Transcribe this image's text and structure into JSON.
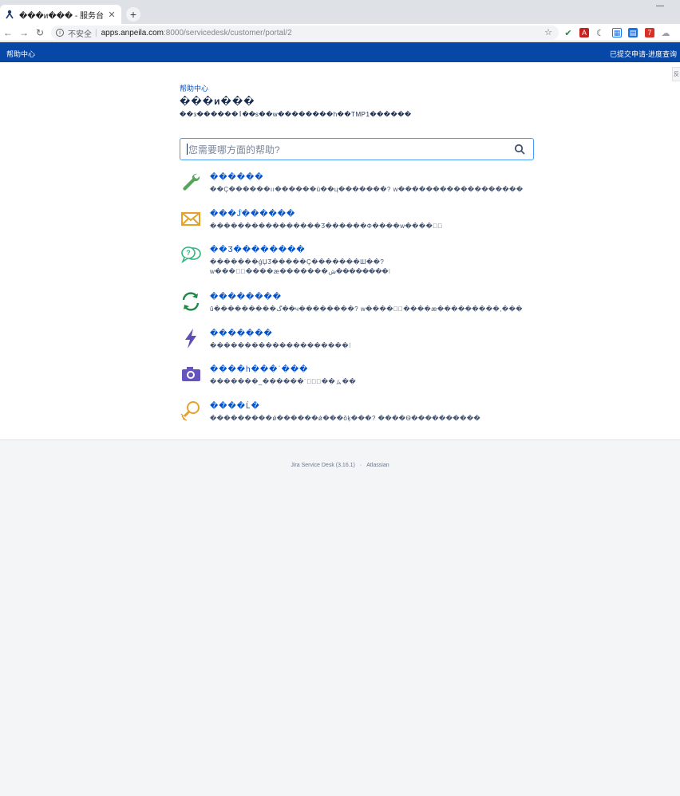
{
  "browser": {
    "tab_title": "���и��� - 服务台",
    "new_tab": "+",
    "win_min": "—",
    "url_insecure": "不安全",
    "url_host": "apps.anpeila.com",
    "url_path": ":8000/servicedesk/customer/portal/2"
  },
  "header": {
    "help_center": "帮助中心",
    "requests_link": "已提交申请-进度查询"
  },
  "portal": {
    "breadcrumb": "帮助中心",
    "title": "���и���",
    "description": "��з������ٲ��ѕ��w��������h��TMP1������"
  },
  "search": {
    "placeholder": "您需要哪方面的帮助?"
  },
  "request_types": [
    {
      "icon": "wrench-icon",
      "name": "������",
      "description": "��Ç������ıı������ü��ц�������? w������������������"
    },
    {
      "icon": "envelope-icon",
      "name": "���Ј̈́������",
      "description": "����������������Ӡ������Ф����w�����⃞"
    },
    {
      "icon": "speech-bubbles-icon",
      "name": "��Ӡ��������",
      "description": "�������ǵЏӠ�����Ç�������Ш��? w����⃞����æ�������ش��������⁝"
    },
    {
      "icon": "refresh-icon",
      "name": "��������",
      "description": "û���������گ��ч��������? w�����⃞����æ���������,���"
    },
    {
      "icon": "lightning-icon",
      "name": "�������",
      "description": "��������������������⁝"
    },
    {
      "icon": "camera-icon",
      "name": "����h���ˈ���",
      "description": "�������_������˙�⃞⃞��ㇺ��"
    },
    {
      "icon": "lightbulb-icon",
      "name": "����Ĺ�",
      "description": "���������ǿ������ǿ���ǒķ���? ����Ѳ����������"
    }
  ],
  "footer": {
    "product": "Jira Service Desk (3.16.1)",
    "separator": "·",
    "vendor": "Atlassian"
  },
  "colors": {
    "header_bg": "#0747a6",
    "link": "#0052cc",
    "search_border": "#4c9aff",
    "icon_teal": "#57a55a",
    "icon_orange": "#e5a22a",
    "icon_green": "#36b37e",
    "icon_dkgreen": "#1e8a46",
    "icon_purple": "#5e4db2"
  }
}
